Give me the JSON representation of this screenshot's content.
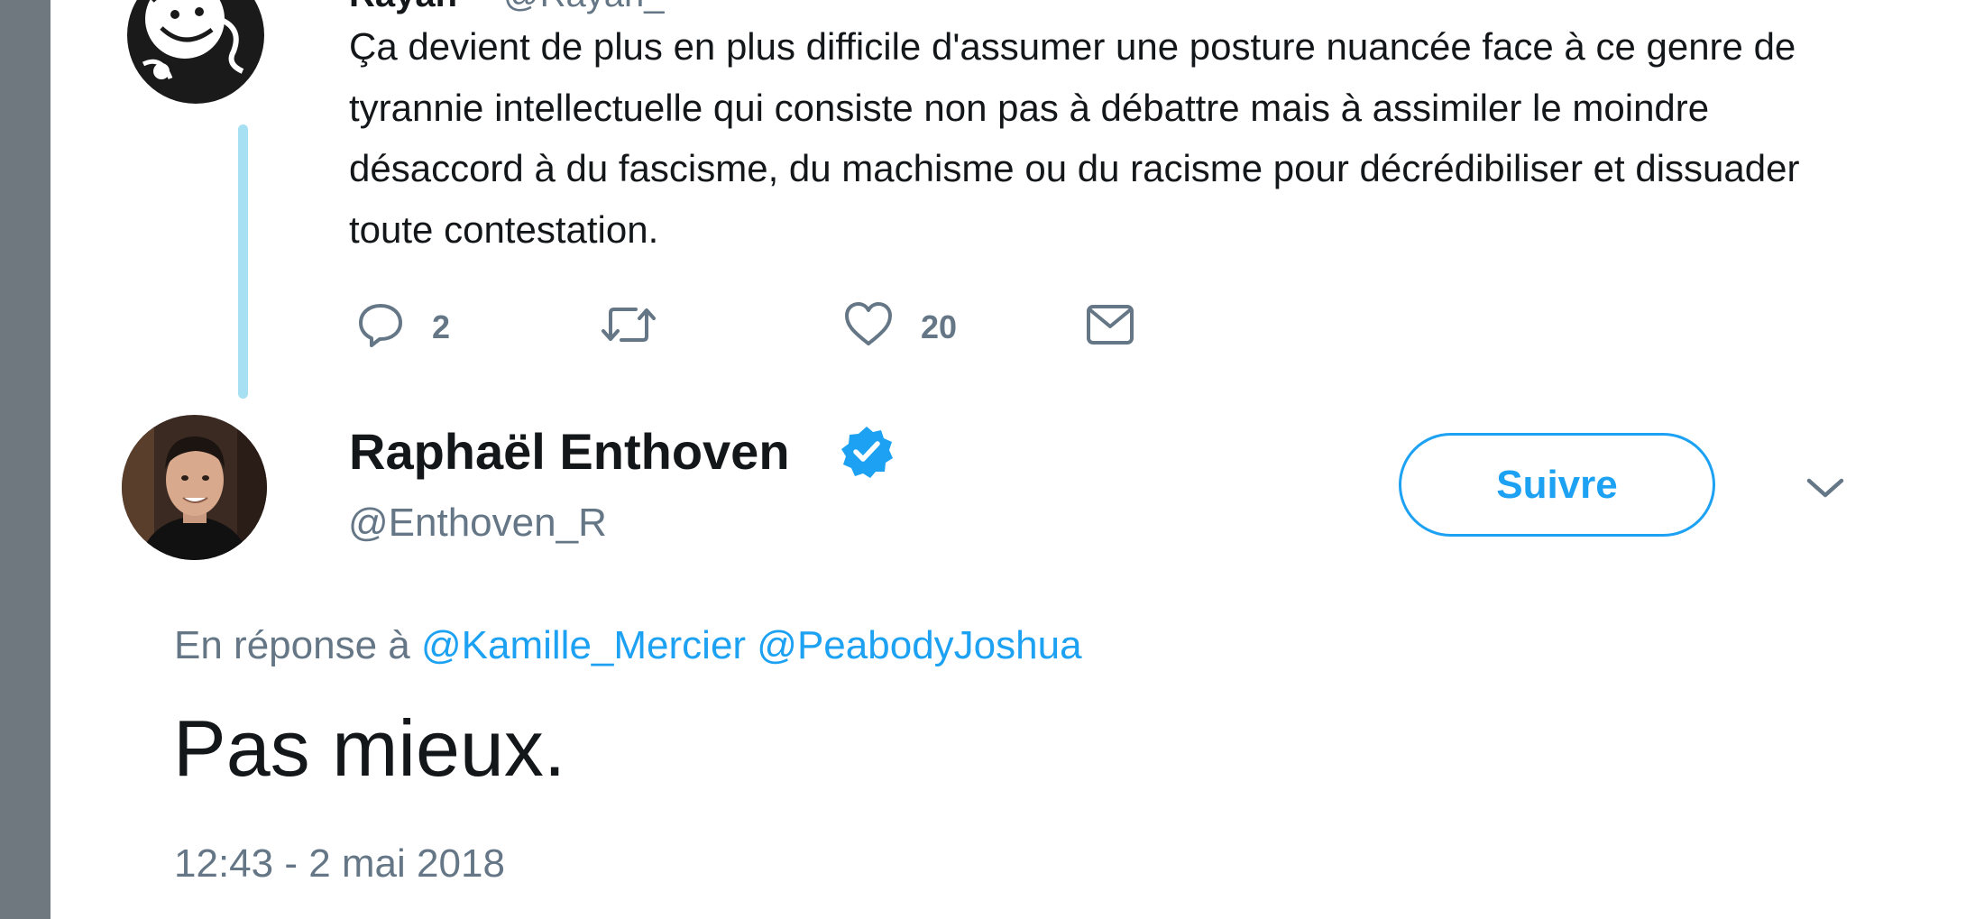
{
  "parent_tweet": {
    "author_name_partial": "Rayan",
    "handle_partial": "@Rayan_",
    "text": "Ça devient de plus en plus difficile d'assumer une posture nuancée face à ce genre de tyrannie intellectuelle qui consiste non pas à débattre mais à assimiler le moindre désaccord à du fascisme, du machisme ou du racisme pour décrédibiliser et dissuader toute contestation.",
    "actions": {
      "reply_icon": "reply-bubble-icon",
      "reply_count": "2",
      "retweet_icon": "retweet-icon",
      "like_icon": "heart-icon",
      "like_count": "20",
      "dm_icon": "envelope-icon"
    }
  },
  "main_tweet": {
    "author_name": "Raphaël Enthoven",
    "verified_icon": "verified-badge-icon",
    "handle": "@Enthoven_R",
    "follow_label": "Suivre",
    "menu_icon": "chevron-down-icon",
    "reply_prefix": "En réponse à",
    "reply_mentions": [
      "@Kamille_Mercier",
      "@PeabodyJoshua"
    ],
    "text": "Pas mieux.",
    "timestamp": "12:43 - 2 mai 2018"
  },
  "colors": {
    "accent": "#1da1f2",
    "text_primary": "#14171a",
    "text_secondary": "#657786",
    "thread_line": "#a6e0f2",
    "gutter": "#70787f"
  }
}
